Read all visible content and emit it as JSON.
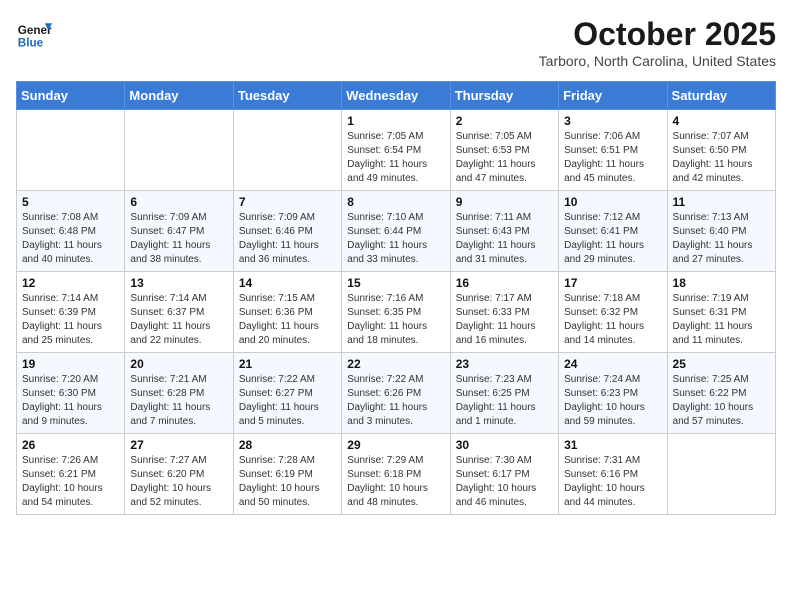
{
  "header": {
    "logo_general": "General",
    "logo_blue": "Blue",
    "month": "October 2025",
    "location": "Tarboro, North Carolina, United States"
  },
  "days_of_week": [
    "Sunday",
    "Monday",
    "Tuesday",
    "Wednesday",
    "Thursday",
    "Friday",
    "Saturday"
  ],
  "weeks": [
    [
      {
        "num": "",
        "info": ""
      },
      {
        "num": "",
        "info": ""
      },
      {
        "num": "",
        "info": ""
      },
      {
        "num": "1",
        "info": "Sunrise: 7:05 AM\nSunset: 6:54 PM\nDaylight: 11 hours and 49 minutes."
      },
      {
        "num": "2",
        "info": "Sunrise: 7:05 AM\nSunset: 6:53 PM\nDaylight: 11 hours and 47 minutes."
      },
      {
        "num": "3",
        "info": "Sunrise: 7:06 AM\nSunset: 6:51 PM\nDaylight: 11 hours and 45 minutes."
      },
      {
        "num": "4",
        "info": "Sunrise: 7:07 AM\nSunset: 6:50 PM\nDaylight: 11 hours and 42 minutes."
      }
    ],
    [
      {
        "num": "5",
        "info": "Sunrise: 7:08 AM\nSunset: 6:48 PM\nDaylight: 11 hours and 40 minutes."
      },
      {
        "num": "6",
        "info": "Sunrise: 7:09 AM\nSunset: 6:47 PM\nDaylight: 11 hours and 38 minutes."
      },
      {
        "num": "7",
        "info": "Sunrise: 7:09 AM\nSunset: 6:46 PM\nDaylight: 11 hours and 36 minutes."
      },
      {
        "num": "8",
        "info": "Sunrise: 7:10 AM\nSunset: 6:44 PM\nDaylight: 11 hours and 33 minutes."
      },
      {
        "num": "9",
        "info": "Sunrise: 7:11 AM\nSunset: 6:43 PM\nDaylight: 11 hours and 31 minutes."
      },
      {
        "num": "10",
        "info": "Sunrise: 7:12 AM\nSunset: 6:41 PM\nDaylight: 11 hours and 29 minutes."
      },
      {
        "num": "11",
        "info": "Sunrise: 7:13 AM\nSunset: 6:40 PM\nDaylight: 11 hours and 27 minutes."
      }
    ],
    [
      {
        "num": "12",
        "info": "Sunrise: 7:14 AM\nSunset: 6:39 PM\nDaylight: 11 hours and 25 minutes."
      },
      {
        "num": "13",
        "info": "Sunrise: 7:14 AM\nSunset: 6:37 PM\nDaylight: 11 hours and 22 minutes."
      },
      {
        "num": "14",
        "info": "Sunrise: 7:15 AM\nSunset: 6:36 PM\nDaylight: 11 hours and 20 minutes."
      },
      {
        "num": "15",
        "info": "Sunrise: 7:16 AM\nSunset: 6:35 PM\nDaylight: 11 hours and 18 minutes."
      },
      {
        "num": "16",
        "info": "Sunrise: 7:17 AM\nSunset: 6:33 PM\nDaylight: 11 hours and 16 minutes."
      },
      {
        "num": "17",
        "info": "Sunrise: 7:18 AM\nSunset: 6:32 PM\nDaylight: 11 hours and 14 minutes."
      },
      {
        "num": "18",
        "info": "Sunrise: 7:19 AM\nSunset: 6:31 PM\nDaylight: 11 hours and 11 minutes."
      }
    ],
    [
      {
        "num": "19",
        "info": "Sunrise: 7:20 AM\nSunset: 6:30 PM\nDaylight: 11 hours and 9 minutes."
      },
      {
        "num": "20",
        "info": "Sunrise: 7:21 AM\nSunset: 6:28 PM\nDaylight: 11 hours and 7 minutes."
      },
      {
        "num": "21",
        "info": "Sunrise: 7:22 AM\nSunset: 6:27 PM\nDaylight: 11 hours and 5 minutes."
      },
      {
        "num": "22",
        "info": "Sunrise: 7:22 AM\nSunset: 6:26 PM\nDaylight: 11 hours and 3 minutes."
      },
      {
        "num": "23",
        "info": "Sunrise: 7:23 AM\nSunset: 6:25 PM\nDaylight: 11 hours and 1 minute."
      },
      {
        "num": "24",
        "info": "Sunrise: 7:24 AM\nSunset: 6:23 PM\nDaylight: 10 hours and 59 minutes."
      },
      {
        "num": "25",
        "info": "Sunrise: 7:25 AM\nSunset: 6:22 PM\nDaylight: 10 hours and 57 minutes."
      }
    ],
    [
      {
        "num": "26",
        "info": "Sunrise: 7:26 AM\nSunset: 6:21 PM\nDaylight: 10 hours and 54 minutes."
      },
      {
        "num": "27",
        "info": "Sunrise: 7:27 AM\nSunset: 6:20 PM\nDaylight: 10 hours and 52 minutes."
      },
      {
        "num": "28",
        "info": "Sunrise: 7:28 AM\nSunset: 6:19 PM\nDaylight: 10 hours and 50 minutes."
      },
      {
        "num": "29",
        "info": "Sunrise: 7:29 AM\nSunset: 6:18 PM\nDaylight: 10 hours and 48 minutes."
      },
      {
        "num": "30",
        "info": "Sunrise: 7:30 AM\nSunset: 6:17 PM\nDaylight: 10 hours and 46 minutes."
      },
      {
        "num": "31",
        "info": "Sunrise: 7:31 AM\nSunset: 6:16 PM\nDaylight: 10 hours and 44 minutes."
      },
      {
        "num": "",
        "info": ""
      }
    ]
  ]
}
